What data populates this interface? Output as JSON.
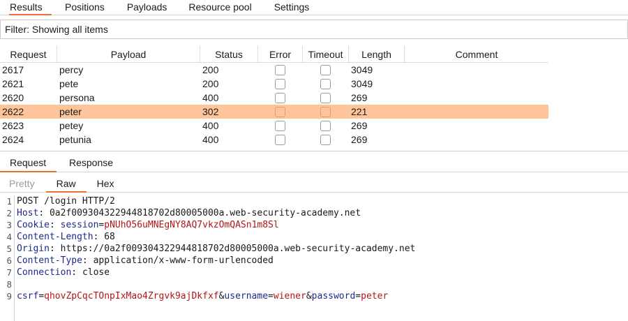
{
  "top_tabs": [
    {
      "label": "Results",
      "active": true
    },
    {
      "label": "Positions"
    },
    {
      "label": "Payloads"
    },
    {
      "label": "Resource pool"
    },
    {
      "label": "Settings"
    }
  ],
  "filter": {
    "text": "Filter: Showing all items"
  },
  "table": {
    "headers": [
      "Request",
      "Payload",
      "Status",
      "Error",
      "Timeout",
      "Length",
      "Comment"
    ],
    "rows": [
      {
        "request": "2617",
        "payload": "percy",
        "status": "200",
        "length": "3049"
      },
      {
        "request": "2621",
        "payload": "pete",
        "status": "200",
        "length": "3049"
      },
      {
        "request": "2620",
        "payload": "persona",
        "status": "400",
        "length": "269"
      },
      {
        "request": "2622",
        "payload": "peter",
        "status": "302",
        "length": "221",
        "selected": true
      },
      {
        "request": "2623",
        "payload": "petey",
        "status": "400",
        "length": "269"
      },
      {
        "request": "2624",
        "payload": "petunia",
        "status": "400",
        "length": "269"
      }
    ]
  },
  "rr_tabs": [
    {
      "label": "Request",
      "active": true
    },
    {
      "label": "Response"
    }
  ],
  "view_tabs": [
    {
      "label": "Pretty",
      "muted": true
    },
    {
      "label": "Raw",
      "active": true
    },
    {
      "label": "Hex"
    }
  ],
  "editor": {
    "line_numbers": [
      "1",
      "2",
      "3",
      "4",
      "5",
      "6",
      "7",
      "8",
      "9"
    ],
    "request_line": "POST /login HTTP/2",
    "headers": [
      {
        "key": "Host",
        "value": "0a2f009304322944818702d80005000a.web-security-academy.net"
      },
      {
        "key": "Cookie",
        "cookie_name": "session",
        "cookie_value": "pNUhO56uMNEgNY8AQ7vkzOmQASn1m8Sl"
      },
      {
        "key": "Content-Length",
        "value": "68"
      },
      {
        "key": "Origin",
        "value": "https://0a2f009304322944818702d80005000a.web-security-academy.net"
      },
      {
        "key": "Content-Type",
        "value": "application/x-www-form-urlencoded"
      },
      {
        "key": "Connection",
        "value": "close"
      }
    ],
    "body": [
      {
        "key": "csrf",
        "value": "qhovZpCqcTOnpIxMao4Zrgvk9ajDkfxf"
      },
      {
        "key": "username",
        "value": "wiener"
      },
      {
        "key": "password",
        "value": "peter"
      }
    ]
  }
}
